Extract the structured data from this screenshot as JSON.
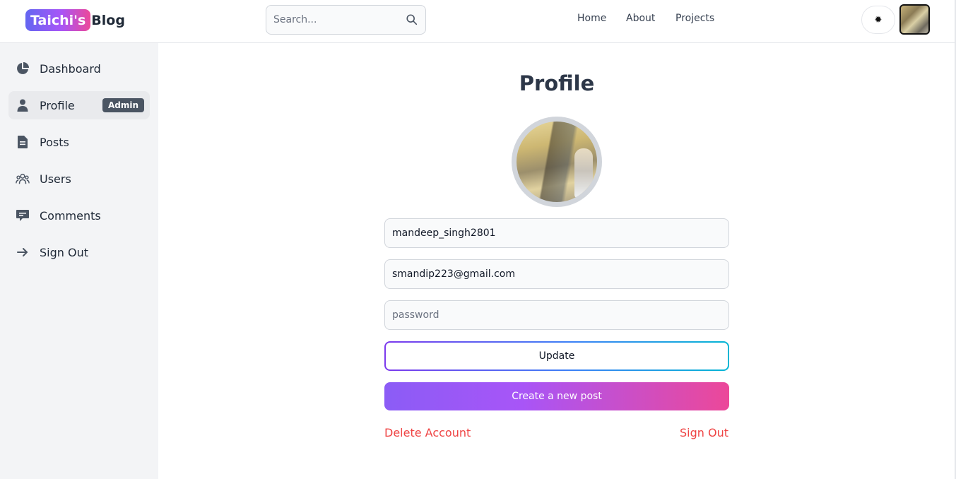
{
  "header": {
    "brand_highlight": "Taichi's",
    "brand_rest": "Blog",
    "search_placeholder": "Search...",
    "nav": [
      "Home",
      "About",
      "Projects"
    ],
    "theme_icon": "✹"
  },
  "sidebar": {
    "items": [
      {
        "label": "Dashboard",
        "icon": "pie-chart-icon"
      },
      {
        "label": "Profile",
        "icon": "user-icon",
        "badge": "Admin",
        "active": true
      },
      {
        "label": "Posts",
        "icon": "document-icon"
      },
      {
        "label": "Users",
        "icon": "users-icon"
      },
      {
        "label": "Comments",
        "icon": "comment-icon"
      },
      {
        "label": "Sign Out",
        "icon": "arrow-right-icon"
      }
    ]
  },
  "main": {
    "title": "Profile",
    "username": "mandeep_singh2801",
    "email": "smandip223@gmail.com",
    "password_placeholder": "password",
    "update_label": "Update",
    "create_post_label": "Create a new post",
    "delete_account_label": "Delete Account",
    "sign_out_label": "Sign Out"
  },
  "colors": {
    "danger": "#ef4444",
    "badge": "#4b5563",
    "gradient_start": "#8b5cf6",
    "gradient_end": "#ec4899"
  }
}
